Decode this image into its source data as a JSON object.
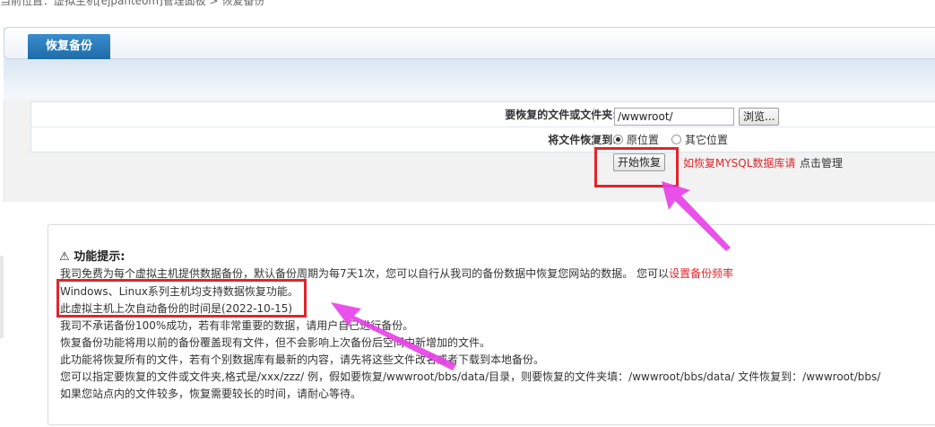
{
  "breadcrumb": "当前位置：虚拟主机[ejpanteom]管理面板 > 恢复备份",
  "tab_label": "恢复备份",
  "form": {
    "path_label": "要恢复的文件或文件夹:",
    "path_value": "/wwwroot/",
    "browse_label": "浏览...",
    "restore_to_label": "将文件恢复到:",
    "option_original": "原位置",
    "option_other": "其它位置",
    "start_button": "开始恢复",
    "mysql_note": "如恢复MYSQL数据库请",
    "manage_note": "点击管理"
  },
  "tips": {
    "title": "功能提示:",
    "lines": [
      "我司免费为每个虚拟主机提供数据备份，默认备份周期为每7天1次，您可以自行从我司的备份数据中恢复您网站的数据。 您可以",
      "Windows、Linux系列主机均支持数据恢复功能。",
      "此虚拟主机上次自动备份的时间是(2022-10-15)",
      "我司不承诺备份100%成功，若有非常重要的数据，请用户自己进行备份。",
      "恢复备份功能将用以前的备份覆盖现有文件，但不会影响上次备份后空间中新增加的文件。",
      "此功能将恢复所有的文件，若有个别数据库有最新的内容，请先将这些文件改名或者下载到本地备份。",
      "您可以指定要恢复的文件或文件夹,格式是/xxx/zzz/ 例，假如要恢复/wwwroot/bbs/data/目录，则要恢复的文件夹填：/wwwroot/bbs/data/  文件恢复到：/wwwroot/bbs/",
      "如果您站点内的文件较多，恢复需要较长的时间，请耐心等待。"
    ],
    "link_set_frequency": "设置备份频率"
  },
  "icons": {
    "warning": "warning-icon"
  },
  "colors": {
    "accent_red": "#e0252b",
    "tab_blue": "#2a7dbd",
    "arrow_magenta": "#e83ee8"
  }
}
